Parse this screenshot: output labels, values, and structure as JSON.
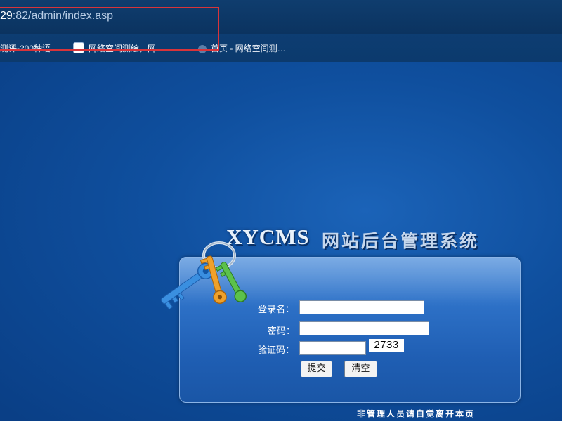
{
  "browser": {
    "url_host": "29",
    "url_rest": ":82/admin/index.asp",
    "bookmarks": [
      {
        "label": "测评-200种语…"
      },
      {
        "label": "网络空间测绘，网…"
      },
      {
        "label": "首页 - 网络空间测…"
      }
    ]
  },
  "brand": {
    "title": "XYCMS",
    "subtitle": "网站后台管理系统"
  },
  "login": {
    "username_label": "登录名：",
    "password_label": "密码：",
    "captcha_label": "验证码：",
    "username_value": "",
    "password_value": "",
    "captcha_value": "",
    "captcha_code": "2733",
    "submit_label": "提交",
    "clear_label": "清空"
  },
  "footer": {
    "note": "非管理人员请自觉离开本页"
  },
  "colors": {
    "background": "#0f4f9e",
    "panel": "#2e72c8",
    "highlight": "#d8343a"
  }
}
